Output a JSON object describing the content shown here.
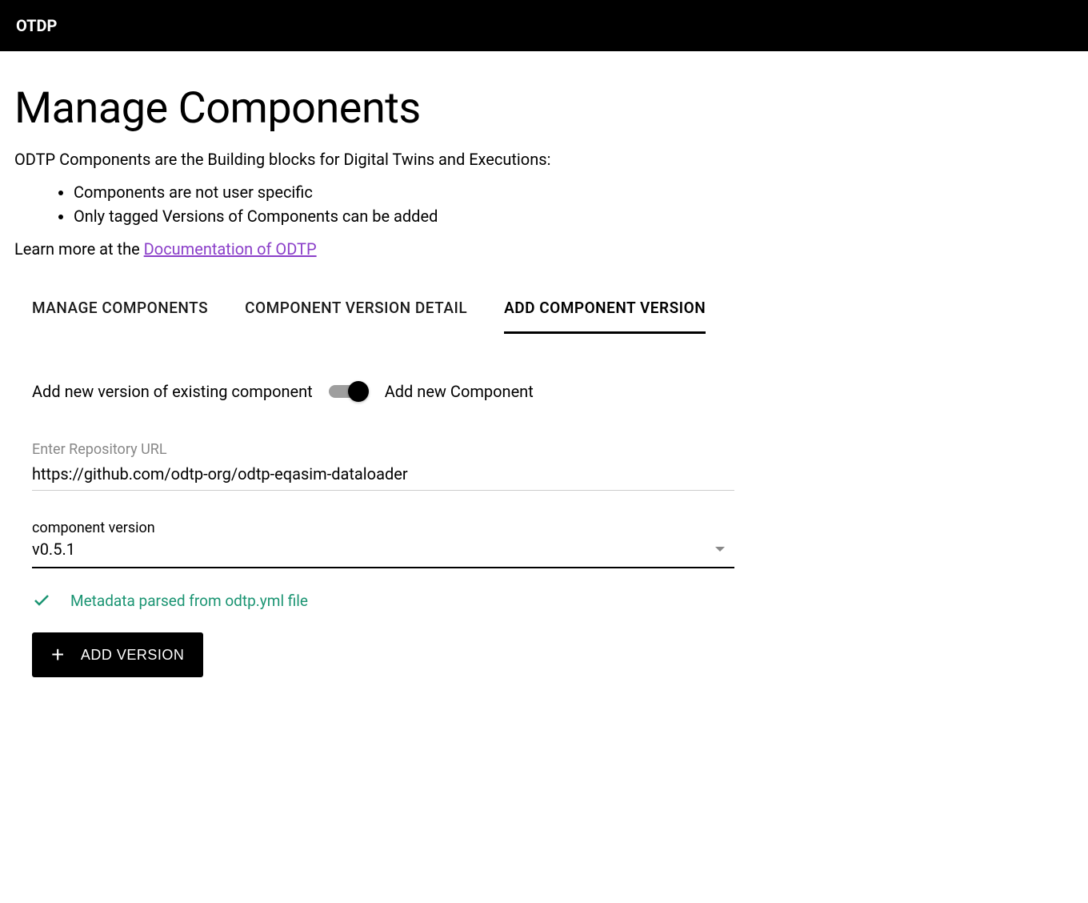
{
  "header": {
    "brand": "OTDP"
  },
  "page": {
    "title": "Manage Components",
    "intro": "ODTP Components are the Building blocks for Digital Twins and Executions:",
    "bullets": [
      "Components are not user specific",
      "Only tagged Versions of Components can be added"
    ],
    "learn_more_prefix": "Learn more at the ",
    "learn_more_link": "Documentation of ODTP"
  },
  "tabs": [
    {
      "label": "MANAGE COMPONENTS",
      "active": false
    },
    {
      "label": "COMPONENT VERSION DETAIL",
      "active": false
    },
    {
      "label": "ADD COMPONENT VERSION",
      "active": true
    }
  ],
  "form": {
    "toggle_left": "Add new version of existing component",
    "toggle_right": "Add new Component",
    "toggle_state": true,
    "repo_label": "Enter Repository URL",
    "repo_value": "https://github.com/odtp-org/odtp-eqasim-dataloader",
    "version_label": "component version",
    "version_value": "v0.5.1",
    "status_message": "Metadata parsed from odtp.yml file",
    "add_button": "ADD VERSION"
  }
}
